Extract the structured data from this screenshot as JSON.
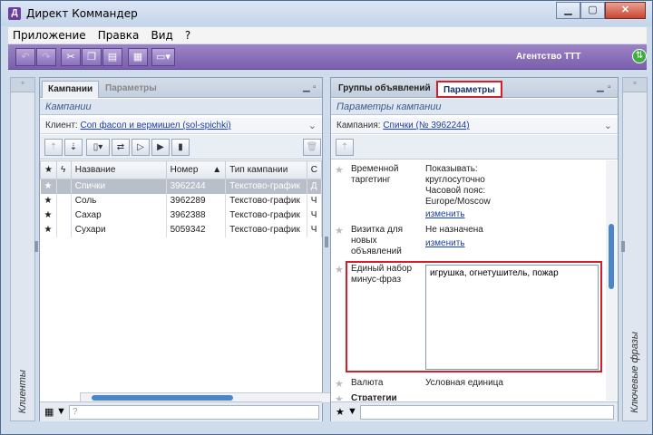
{
  "window": {
    "title": "Директ Коммандер",
    "app_icon": "Д",
    "minimize": "▁",
    "maximize": "▢",
    "close": "✕"
  },
  "menu": [
    "Приложение",
    "Правка",
    "Вид",
    "?"
  ],
  "toolbar": {
    "agency": "Агентство ТТТ",
    "icons": [
      "undo-icon",
      "redo-icon",
      "cut-icon",
      "copy-icon",
      "paste-icon",
      "grid-icon",
      "layout-icon"
    ]
  },
  "left_sidebar": {
    "label": "Клиенты"
  },
  "right_sidebar": {
    "label": "Ключевые фразы"
  },
  "left_panel": {
    "tabs": [
      "Кампании",
      "Параметры"
    ],
    "subtitle": "Кампании",
    "client_label": "Клиент:",
    "client_value": "Соп фасол и вермишел (sol-spichki)",
    "columns": [
      "Название",
      "Номер",
      "Тип кампании",
      "С"
    ],
    "sort_indicator": "▲",
    "rows": [
      {
        "name": "Спички",
        "number": "3962244",
        "type": "Текстово-график",
        "s": "Д",
        "selected": true
      },
      {
        "name": "Соль",
        "number": "3962289",
        "type": "Текстово-график",
        "s": "Ч"
      },
      {
        "name": "Сахар",
        "number": "3962388",
        "type": "Текстово-график",
        "s": "Ч"
      },
      {
        "name": "Сухари",
        "number": "5059342",
        "type": "Текстово-график",
        "s": "Ч"
      }
    ]
  },
  "right_panel": {
    "tabs": [
      "Группы объявлений",
      "Параметры"
    ],
    "subtitle": "Параметры кампании",
    "campaign_label": "Кампания:",
    "campaign_value": "Спички (№ 3962244)",
    "props": {
      "targeting_label": "Временной таргетинг",
      "targeting_lines": [
        "Показывать:",
        "круглосуточно",
        "Часовой пояс:",
        "Europe/Moscow"
      ],
      "targeting_link": "изменить",
      "vcard_label": "Визитка для новых объявлений",
      "vcard_value": "Не назначена",
      "vcard_link": "изменить",
      "minus_label": "Единый набор минус-фраз",
      "minus_value": "игрушка, огнетушитель, пожар",
      "currency_label": "Валюта",
      "currency_value": "Условная единица",
      "strategies_label": "Стратегии"
    }
  }
}
